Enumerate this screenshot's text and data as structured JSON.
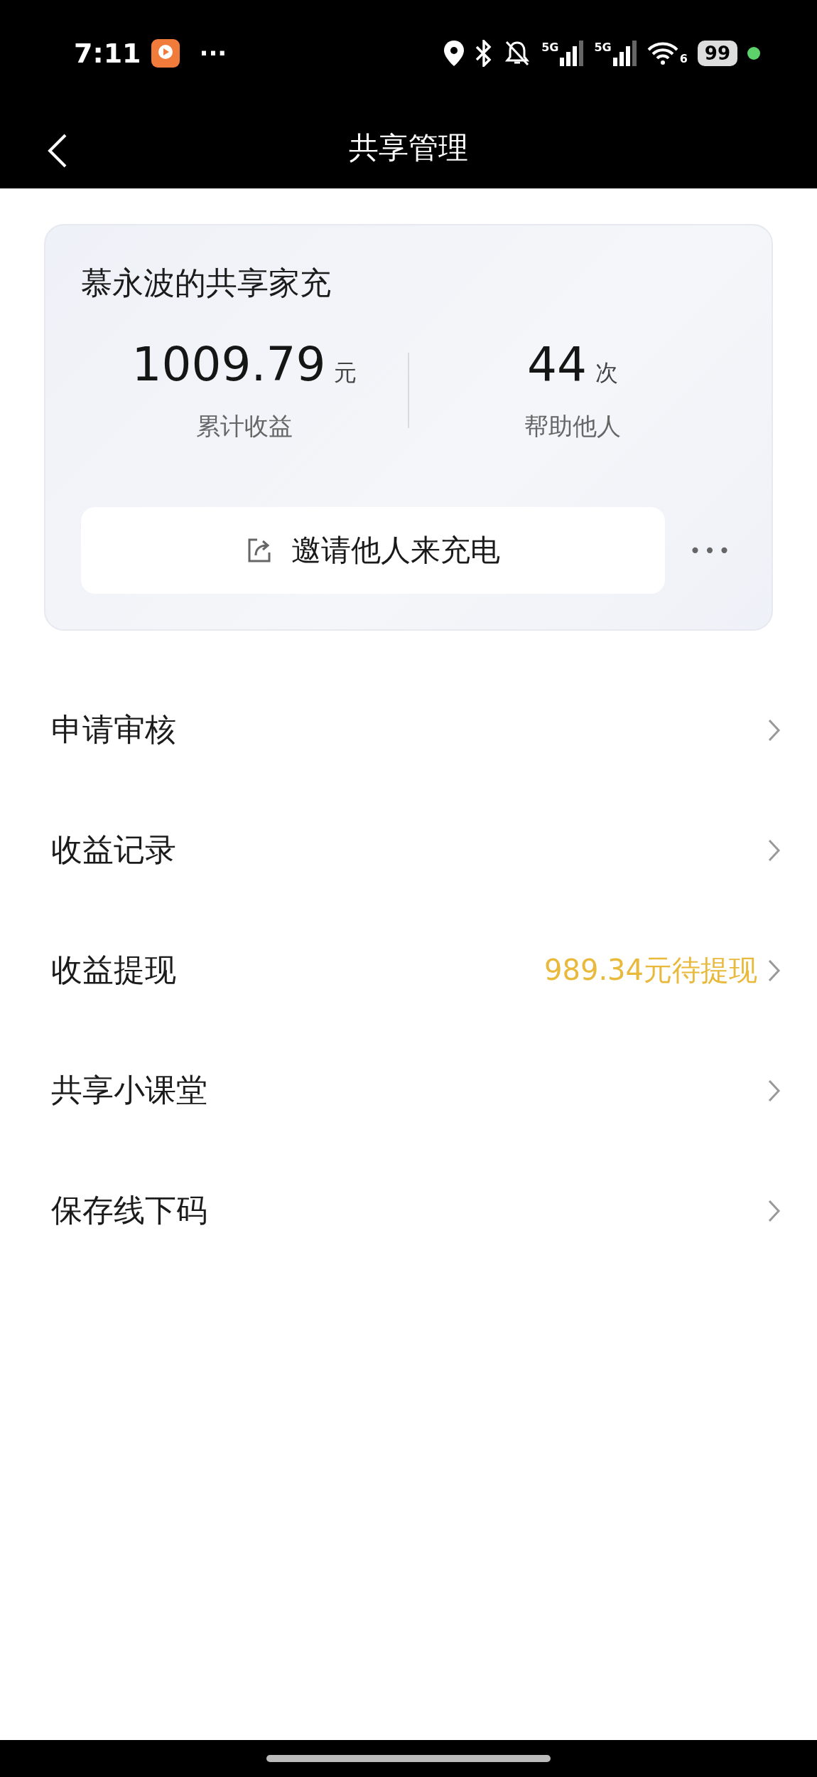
{
  "status_bar": {
    "time": "7:11",
    "more": "···",
    "signals": [
      {
        "label": "5G"
      },
      {
        "label": "5G"
      }
    ],
    "wifi_label": "6",
    "battery": "99"
  },
  "header": {
    "title": "共享管理"
  },
  "card": {
    "title": "慕永波的共享家充",
    "stats": [
      {
        "value": "1009.79",
        "unit": "元",
        "label": "累计收益"
      },
      {
        "value": "44",
        "unit": "次",
        "label": "帮助他人"
      }
    ],
    "invite_button": "邀请他人来充电",
    "more": "•••"
  },
  "menu": [
    {
      "label": "申请审核"
    },
    {
      "label": "收益记录"
    },
    {
      "label": "收益提现",
      "value": "989.34元待提现"
    },
    {
      "label": "共享小课堂"
    },
    {
      "label": "保存线下码"
    }
  ]
}
